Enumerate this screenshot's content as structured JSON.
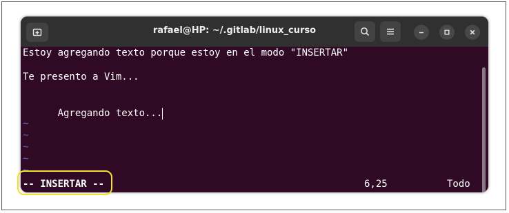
{
  "window": {
    "title": "rafael@HP: ~/.gitlab/linux_curso",
    "buttons": {
      "new_tab_icon": "new-tab-icon",
      "search_icon": "search-icon",
      "menu_icon": "hamburger-menu-icon",
      "minimize_icon": "minimize-icon",
      "maximize_icon": "maximize-icon",
      "close_icon": "close-icon"
    }
  },
  "terminal": {
    "lines": [
      "Estoy agregando texto porque estoy en el modo \"INSERTAR\"",
      "Te presento a Vim...",
      "      Agregando texto..."
    ],
    "tilde": "~",
    "status": {
      "mode": "-- INSERTAR --",
      "position": "6,25",
      "scroll": "Todo"
    }
  },
  "colors": {
    "terminal_bg": "#300a24",
    "titlebar_bg": "#303030",
    "tilde": "#5a6cd6",
    "highlight": "#f2e02a"
  }
}
